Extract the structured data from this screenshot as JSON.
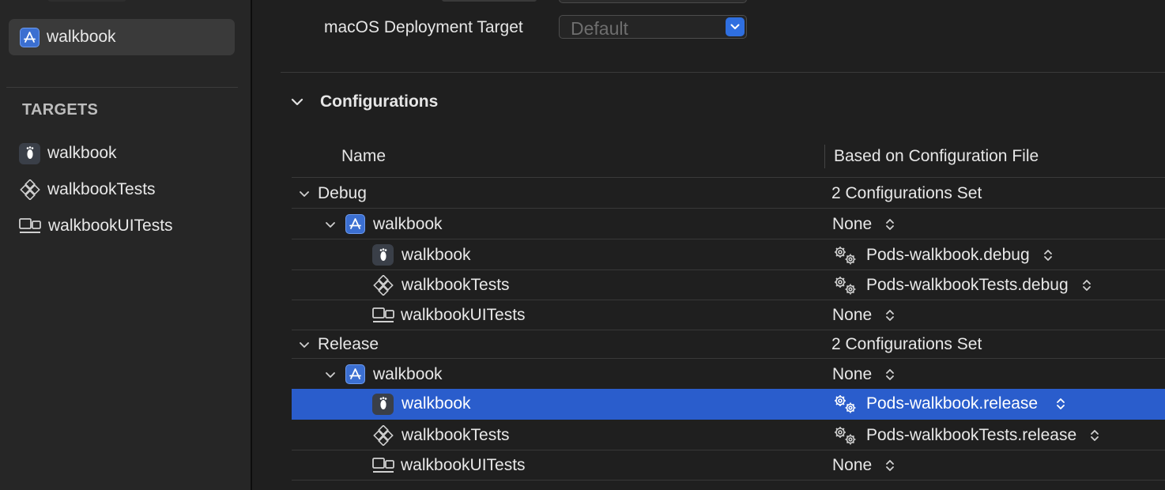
{
  "sidebar": {
    "project": {
      "label": "walkbook",
      "icon": "app-store-icon"
    },
    "targets_header": "TARGETS",
    "targets": [
      {
        "label": "walkbook",
        "icon": "footprint-icon"
      },
      {
        "label": "walkbookTests",
        "icon": "test-diamond-icon"
      },
      {
        "label": "walkbookUITests",
        "icon": "ui-test-icon"
      }
    ]
  },
  "deployment": {
    "label": "macOS Deployment Target",
    "value": "Default"
  },
  "configurations": {
    "title": "Configurations",
    "columns": {
      "name": "Name",
      "based_on": "Based on Configuration File"
    },
    "groups": [
      {
        "name": "Debug",
        "summary": "2 Configurations Set",
        "project": {
          "name": "walkbook",
          "file": "None"
        },
        "targets": [
          {
            "name": "walkbook",
            "file": "Pods-walkbook.debug"
          },
          {
            "name": "walkbookTests",
            "file": "Pods-walkbookTests.debug"
          },
          {
            "name": "walkbookUITests",
            "file": "None"
          }
        ]
      },
      {
        "name": "Release",
        "summary": "2 Configurations Set",
        "project": {
          "name": "walkbook",
          "file": "None"
        },
        "targets": [
          {
            "name": "walkbook",
            "file": "Pods-walkbook.release",
            "selected": true
          },
          {
            "name": "walkbookTests",
            "file": "Pods-walkbookTests.release"
          },
          {
            "name": "walkbookUITests",
            "file": "None"
          }
        ]
      }
    ]
  },
  "colors": {
    "selection": "#2a5dcc",
    "accent": "#2f6fe0",
    "background": "#1f1f1f",
    "sidebar": "#262626"
  }
}
